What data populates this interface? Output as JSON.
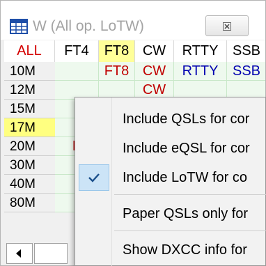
{
  "window": {
    "title": "W (All op. LoTW)",
    "icon": "grid-table-icon",
    "close_icon": "close-icon"
  },
  "grid": {
    "columns": [
      "ALL",
      "FT4",
      "FT8",
      "CW",
      "RTTY",
      "SSB"
    ],
    "selected_column": "FT8",
    "rows": [
      {
        "band": "10M",
        "highlight": false,
        "cells": {
          "FT8": "FT8",
          "CW": "CW",
          "RTTY": "RTTY",
          "SSB": "SSB"
        }
      },
      {
        "band": "12M",
        "highlight": false,
        "cells": {
          "CW": "CW"
        }
      },
      {
        "band": "15M",
        "highlight": false,
        "cells": {}
      },
      {
        "band": "17M",
        "highlight": true,
        "cells": {}
      },
      {
        "band": "20M",
        "highlight": false,
        "cells": {
          "FT4": "F"
        }
      },
      {
        "band": "30M",
        "highlight": false,
        "cells": {}
      },
      {
        "band": "40M",
        "highlight": false,
        "cells": {}
      },
      {
        "band": "80M",
        "highlight": false,
        "cells": {}
      }
    ],
    "colors": {
      "all_header": "#d40000",
      "cell_red": "#c00000",
      "cell_blue": "#0000b0",
      "highlight": "#ffff80"
    }
  },
  "scrollbar": {
    "left_arrow_icon": "chevron-left-icon"
  },
  "context_menu": {
    "items": [
      {
        "label": "Include QSLs for cor",
        "checked": false
      },
      {
        "label": "Include eQSL for cor",
        "checked": false
      },
      {
        "label": "Include LoTW for co",
        "checked": true
      },
      {
        "label": "Paper QSLs only for",
        "checked": false
      },
      {
        "label": "Show DXCC info for",
        "checked": false
      }
    ],
    "check_icon": "checkmark-icon"
  }
}
